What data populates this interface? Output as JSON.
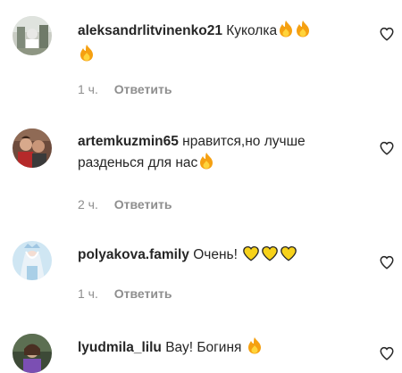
{
  "comments": [
    {
      "username": "aleksandrlitvinenko21",
      "text": "Куколка",
      "emojis": [
        "fire",
        "fire",
        "fire"
      ],
      "time": "1 ч.",
      "reply_label": "Ответить",
      "avatar": "avatar-photo-outdoor"
    },
    {
      "username": "artemkuzmin65",
      "text": "нравится,но лучше разденься для нас",
      "emojis": [
        "fire"
      ],
      "time": "2 ч.",
      "reply_label": "Ответить",
      "avatar": "avatar-photo-couple"
    },
    {
      "username": "polyakova.family",
      "text": "Очень!",
      "emojis": [
        "yellow-heart",
        "yellow-heart",
        "yellow-heart"
      ],
      "time": "1 ч.",
      "reply_label": "Ответить",
      "avatar": "avatar-photo-princess"
    },
    {
      "username": "lyudmila_lilu",
      "text": "Вау! Богиня",
      "emojis": [
        "fire"
      ],
      "time": "",
      "reply_label": "",
      "avatar": "avatar-photo-woman"
    }
  ],
  "icons": {
    "like": "heart-outline-icon",
    "fire": "fire-emoji",
    "yellow_heart": "yellow-heart-emoji"
  },
  "colors": {
    "text": "#262626",
    "meta": "#8e8e8e",
    "fire_outer": "#f5a011",
    "fire_inner": "#ffd43b",
    "heart_yellow": "#f7d21a"
  }
}
